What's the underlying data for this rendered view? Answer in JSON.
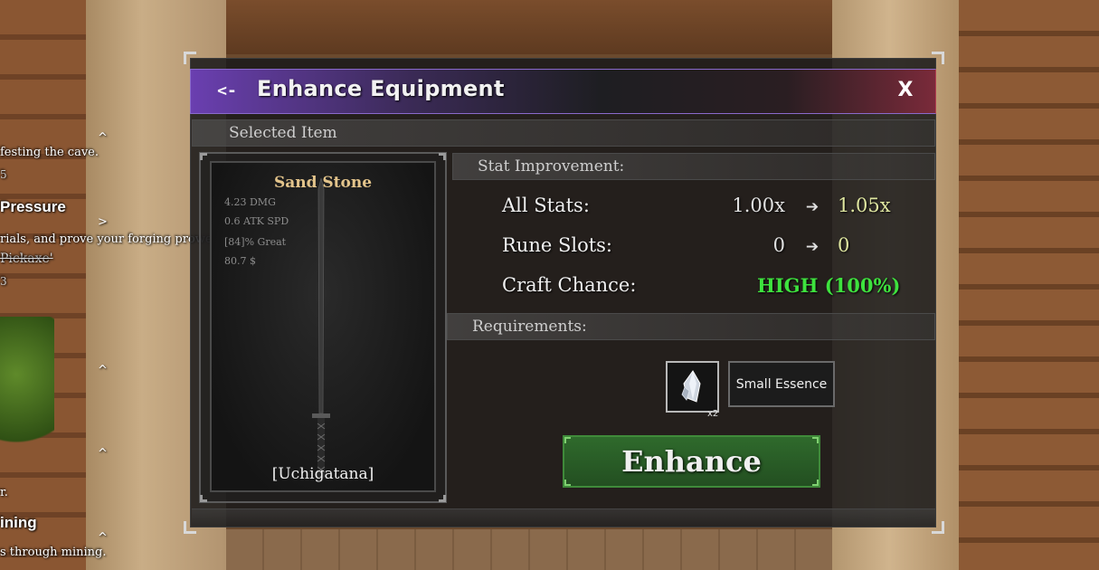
{
  "quest_tracker": {
    "lines": [
      {
        "text": "festing the cave.",
        "style": "small"
      },
      {
        "text": "5",
        "style": "digit"
      },
      {
        "text": "Pressure",
        "style": "big"
      },
      {
        "text": "rials, and prove your forging prowess.",
        "style": "small"
      },
      {
        "text": "Pickaxe'",
        "style": "strike"
      },
      {
        "text": "3",
        "style": "digit"
      },
      {
        "text": "r.",
        "style": "small"
      },
      {
        "text": "ining",
        "style": "big"
      },
      {
        "text": "s through mining.",
        "style": "small"
      }
    ],
    "caret_up": "^",
    "caret_right": ">"
  },
  "window": {
    "back_label": "<-",
    "title": "Enhance Equipment",
    "close_label": "X"
  },
  "selected_item": {
    "header": "Selected Item",
    "name": "Sand Stone",
    "stats": [
      "4.23 DMG",
      "0.6 ATK SPD",
      "[84]% Great",
      "80.7 $"
    ],
    "type": "[Uchigatana]"
  },
  "stat_improvement": {
    "header": "Stat Improvement:",
    "rows": [
      {
        "label": "All Stats:",
        "from": "1.00x",
        "to": "1.05x"
      },
      {
        "label": "Rune Slots:",
        "from": "0",
        "to": "0"
      }
    ],
    "arrow": "➔",
    "craft_chance_label": "Craft Chance:",
    "craft_chance_value": "HIGH (100%)"
  },
  "requirements": {
    "header": "Requirements:",
    "items": [
      {
        "name": "Small Essence",
        "count": "x2",
        "icon": "crystal-icon"
      }
    ]
  },
  "enhance_button": "Enhance",
  "colors": {
    "title_purple": "#6a3fb0",
    "title_red": "#7a2a3a",
    "item_name": "#e3c48b",
    "chance_green": "#3ee23e",
    "button_green": "#2f6a2c"
  }
}
